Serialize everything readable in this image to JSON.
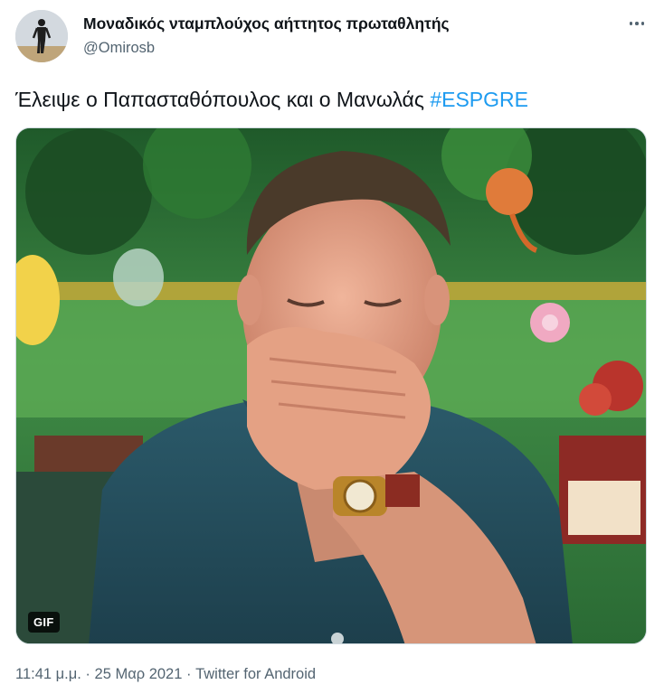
{
  "author": {
    "display_name": "Μοναδικός νταμπλούχος αήττητος πρωταθλητής",
    "handle": "@Omirosb"
  },
  "tweet": {
    "text_before": "Έλειψε ο Παπασταθόπουλος και ο Μανωλάς ",
    "hashtag": "#ESPGRE"
  },
  "media": {
    "badge": "GIF"
  },
  "meta": {
    "time": "11:41 μ.μ.",
    "separator1": " · ",
    "date": "25 Μαρ 2021",
    "separator2": " · ",
    "source": "Twitter for Android"
  },
  "colors": {
    "text": "#0f1419",
    "secondary": "#536471",
    "link": "#1d9bf0"
  },
  "icons": {
    "more": "more-horizontal-icon"
  }
}
